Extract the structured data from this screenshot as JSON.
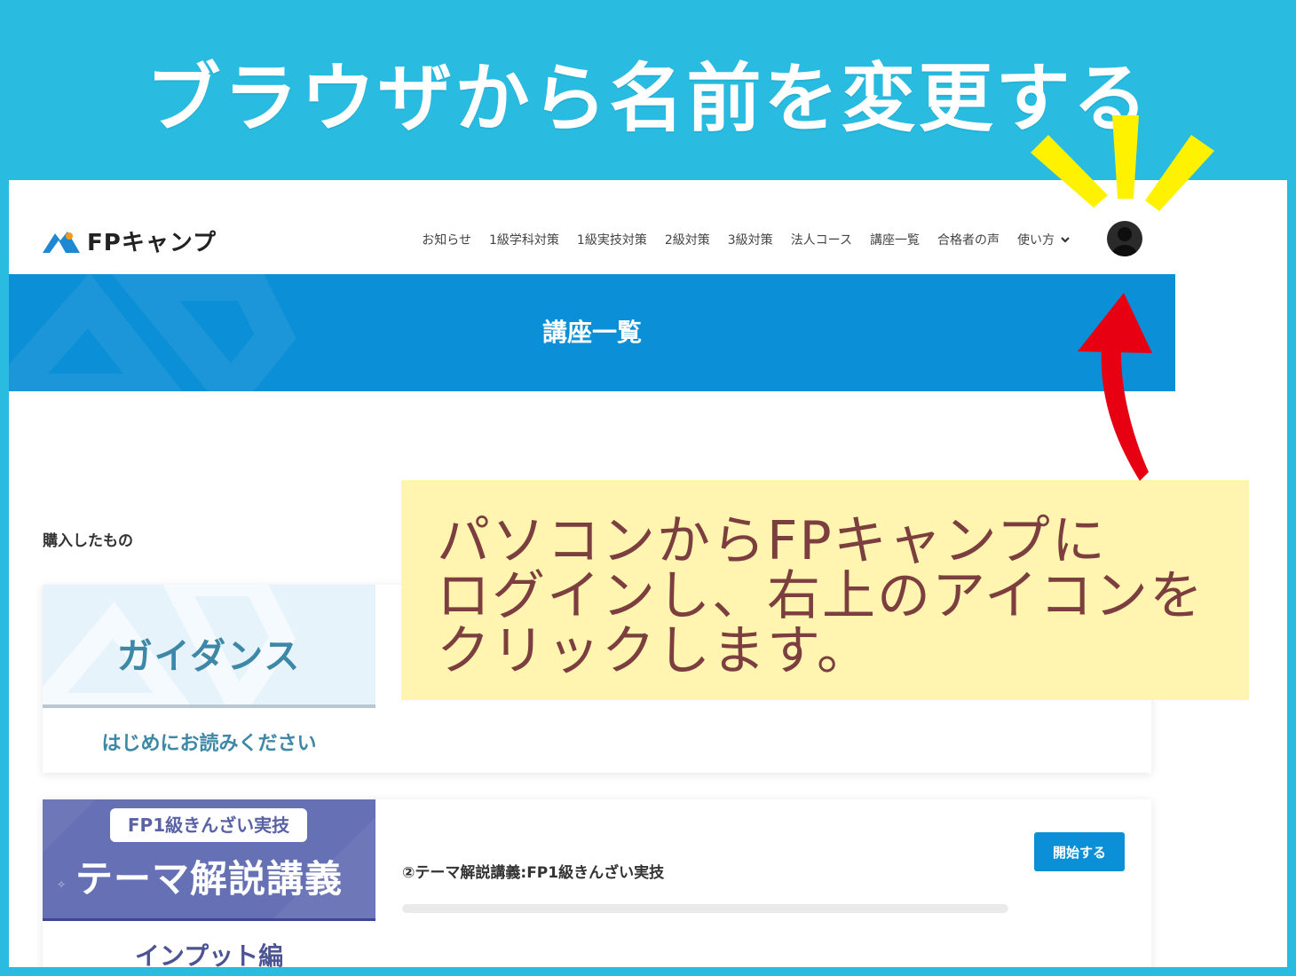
{
  "headline": "ブラウザから名前を変更する",
  "nav": {
    "logo_text": "FPキャンプ",
    "links": [
      "お知らせ",
      "1級学科対策",
      "1級実技対策",
      "2級対策",
      "3級対策",
      "法人コース",
      "講座一覧",
      "合格者の声"
    ],
    "dropdown_label": "使い方"
  },
  "banner": {
    "title": "講座一覧"
  },
  "section_label": "購入したもの",
  "courses": [
    {
      "thumb_title": "ガイダンス",
      "thumb_subtitle": "はじめにお読みください"
    },
    {
      "thumb_tag": "FP1級きんざい実技",
      "thumb_title": "テーマ解説講義",
      "thumb_subtitle": "インプット編",
      "title": "②テーマ解説講義:FP1級きんざい実技",
      "button": "開始する",
      "progress": 0
    }
  ],
  "callout": {
    "lines": [
      "パソコンからFPキャンプに",
      "ログインし、右上のアイコンを",
      "クリックします。"
    ]
  },
  "colors": {
    "background": "#29bbe0",
    "brand_blue": "#0b8fd6",
    "callout_bg": "#fff5b1",
    "callout_text": "#7c3e3e",
    "arrow_red": "#e60012",
    "highlight_yellow": "#fff200"
  }
}
